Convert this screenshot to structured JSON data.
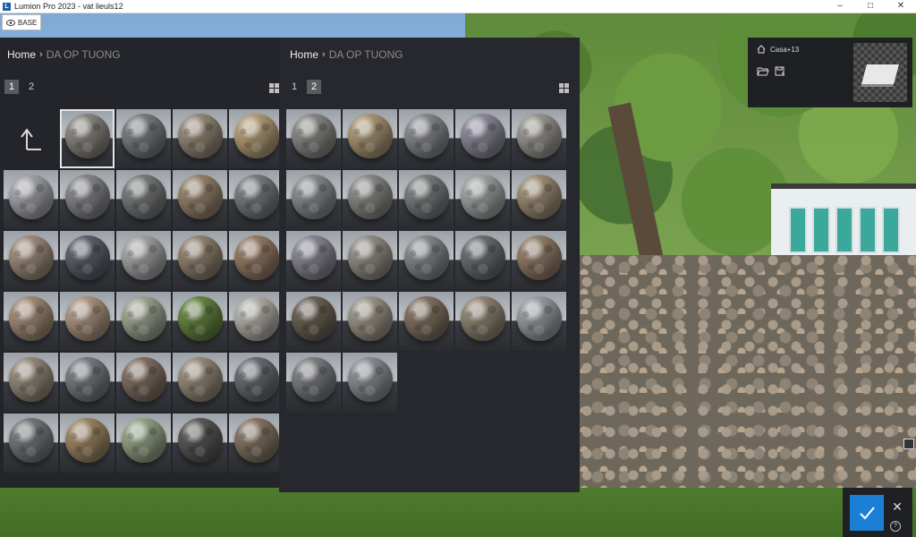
{
  "window": {
    "title": "Lumion Pro 2023 - vat lieuls12",
    "controls": [
      "minimize",
      "maximize",
      "close"
    ]
  },
  "base_button": {
    "label": "BASE",
    "icon": "eye-icon"
  },
  "left_panel": {
    "home_label": "Home",
    "separator": "›",
    "folder_label": "DA OP TUONG",
    "pages": [
      "1",
      "2"
    ],
    "active_page": "1",
    "view_toggle_icon": "grid-icon",
    "back_icon": "up-arrow-icon",
    "materials": [
      "#8f8b84",
      "#7e8186",
      "#9a8d7c",
      "#b9a27b",
      "#a9aab0",
      "#8a8b8e",
      "#7d7f80",
      "#9c8770",
      "#7e8083",
      "#a3917f",
      "#5f6570",
      "#a8aaa9",
      "#968774",
      "#9b8068",
      "#a8907b",
      "#b19a86",
      "#a4aa98",
      "#6a8a45",
      "#b8b6ae",
      "#9a8f80",
      "#7c8085",
      "#857466",
      "#9c8f7f",
      "#6e7075",
      "#7a7d80",
      "#a18b68",
      "#9aa88a",
      "#5d5c5a",
      "#8a7a68"
    ]
  },
  "right_panel": {
    "home_label": "Home",
    "separator": "›",
    "folder_label": "DA OP TUONG",
    "pages": [
      "1",
      "2"
    ],
    "active_page": "2",
    "view_toggle_icon": "grid-icon",
    "materials": [
      "#8e8d8a",
      "#b09c78",
      "#8b8d90",
      "#908f9e",
      "#9f9c96",
      "#8d9094",
      "#8e8f8c",
      "#7e8082",
      "#a6a8a8",
      "#a39278",
      "#8d8c98",
      "#99948a",
      "#8a8e90",
      "#6f7276",
      "#97816c",
      "#6f6658",
      "#a19a8c",
      "#857666",
      "#958a78",
      "#9da2a6",
      "#808286",
      "#8f9399"
    ]
  },
  "project_panel": {
    "name": "Casa+13",
    "icons": [
      "house-icon",
      "folder-open-icon",
      "save-icon"
    ]
  },
  "bottom_controls": {
    "confirm_icon": "checkmark-icon",
    "close_label": "✕",
    "help_label": "?"
  },
  "colors": {
    "panel_bg": "#24252a",
    "accent_blue": "#1c7fd6",
    "breadcrumb_folder": "#8c8c8c"
  }
}
